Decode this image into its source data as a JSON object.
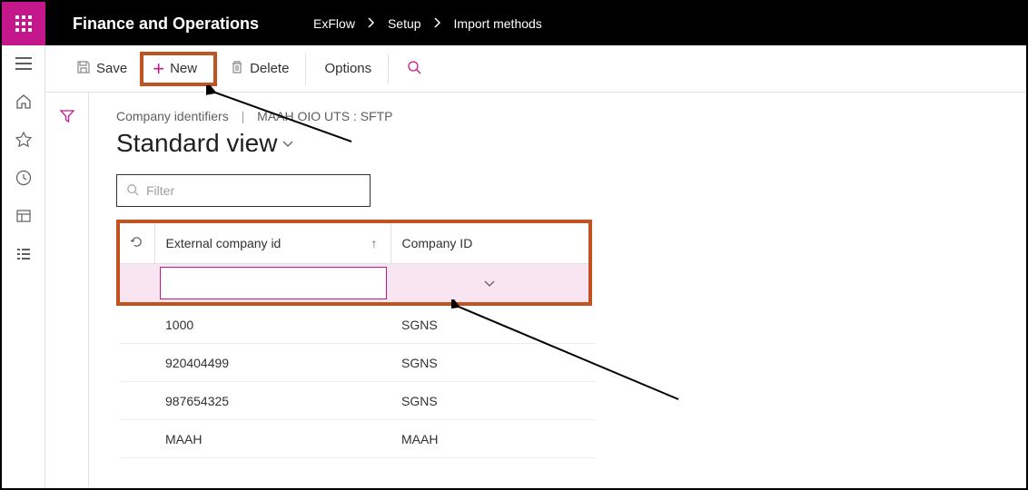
{
  "header": {
    "app_title": "Finance and Operations",
    "breadcrumbs": [
      "ExFlow",
      "Setup",
      "Import methods"
    ]
  },
  "actions": {
    "save": "Save",
    "new": "New",
    "delete": "Delete",
    "options": "Options"
  },
  "page": {
    "subtitle_left": "Company identifiers",
    "subtitle_right": "MAAH OIO UTS : SFTP",
    "view_title": "Standard view",
    "filter_placeholder": "Filter"
  },
  "table": {
    "columns": {
      "ext": "External company id",
      "company": "Company ID"
    },
    "rows": [
      {
        "ext": "1000",
        "company": "SGNS"
      },
      {
        "ext": "920404499",
        "company": "SGNS"
      },
      {
        "ext": "987654325",
        "company": "SGNS"
      },
      {
        "ext": "MAAH",
        "company": "MAAH"
      }
    ]
  }
}
